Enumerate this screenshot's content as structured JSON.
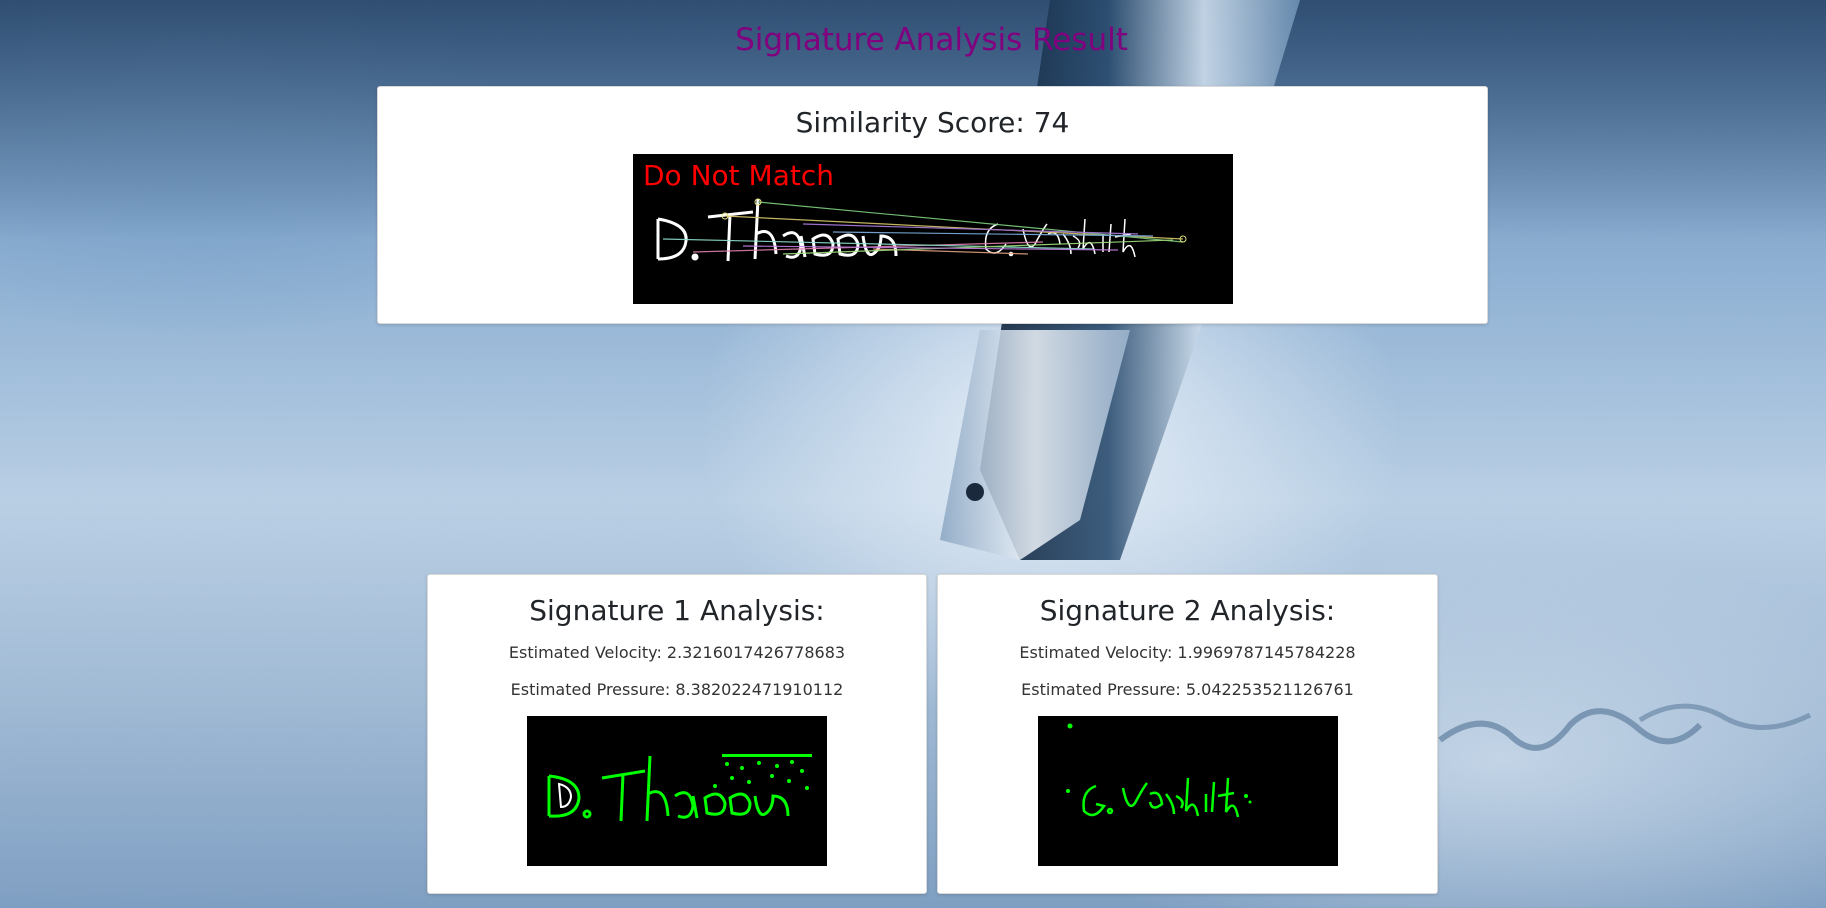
{
  "page": {
    "title": "Signature Analysis Result"
  },
  "similarity": {
    "label": "Similarity Score:",
    "score": "74",
    "heading": "Similarity Score: 74",
    "verdict": "Do Not Match"
  },
  "signature1": {
    "heading": "Signature 1 Analysis:",
    "velocity_text": "Estimated Velocity: 2.3216017426778683",
    "pressure_text": "Estimated Pressure: 8.382022471910112",
    "velocity": 2.3216017426778683,
    "pressure": 8.382022471910112
  },
  "signature2": {
    "heading": "Signature 2 Analysis:",
    "velocity_text": "Estimated Velocity: 1.9969787145784228",
    "pressure_text": "Estimated Pressure: 5.042253521126761",
    "velocity": 1.9969787145784228,
    "pressure": 5.042253521126761
  },
  "colors": {
    "title": "#800080",
    "verdict": "#ff0000",
    "contour": "#00ff00",
    "image_background": "#000000"
  }
}
